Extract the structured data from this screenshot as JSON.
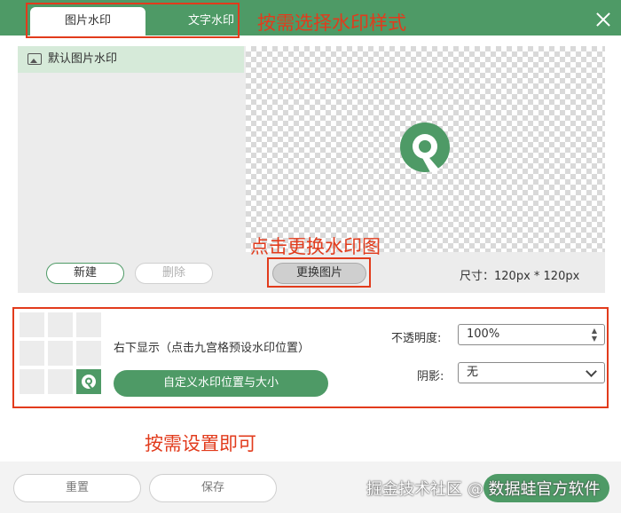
{
  "tabs": [
    {
      "label": "图片水印",
      "active": true
    },
    {
      "label": "文字水印",
      "active": false
    }
  ],
  "annotations": {
    "tabs_note": "按需选择水印样式",
    "change_note": "点击更换水印图",
    "settings_note": "按需设置即可"
  },
  "image_list": {
    "items": [
      {
        "label": "默认图片水印",
        "selected": true
      }
    ]
  },
  "buttons": {
    "new": "新建",
    "delete": "删除",
    "change_image": "更换图片",
    "custom_position": "自定义水印位置与大小",
    "reset": "重置",
    "save": "保存"
  },
  "image_size": "尺寸：120px * 120px",
  "position": {
    "label": "右下显示（点击九宫格预设水印位置）",
    "selected_cell": "bottom-right"
  },
  "opacity": {
    "label": "不透明度:",
    "value": "100%"
  },
  "shadow": {
    "label": "阴影:",
    "value": "无"
  },
  "watermark_text": "掘金技术社区 @ 数据蛙官方软件",
  "colors": {
    "brand_green": "#4e9a66",
    "annotation_red": "#e23b1c",
    "selected_row": "#d6ead9"
  },
  "icons": [
    "close-icon",
    "image-icon",
    "logo-icon",
    "spinner-icon",
    "chevron-down-icon"
  ]
}
